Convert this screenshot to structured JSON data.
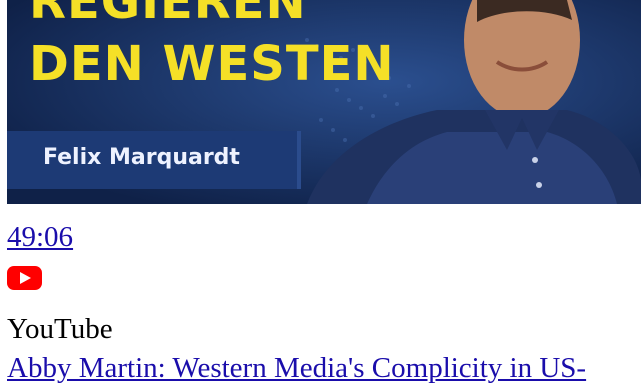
{
  "video": {
    "thumbnail": {
      "title_line_1": "REGIEREN",
      "title_line_2": "DEN WESTEN",
      "author": "Felix Marquardt"
    },
    "duration": "49:06",
    "source_icon": "youtube-play-icon",
    "source": "YouTube",
    "accent_color": "#ff0000"
  },
  "next_video": {
    "title": "Abby Martin: Western Media's Complicity in US-"
  },
  "colors": {
    "link": "#1a0dab",
    "thumb_title": "#f5e027",
    "thumb_bg": "#142a55"
  }
}
